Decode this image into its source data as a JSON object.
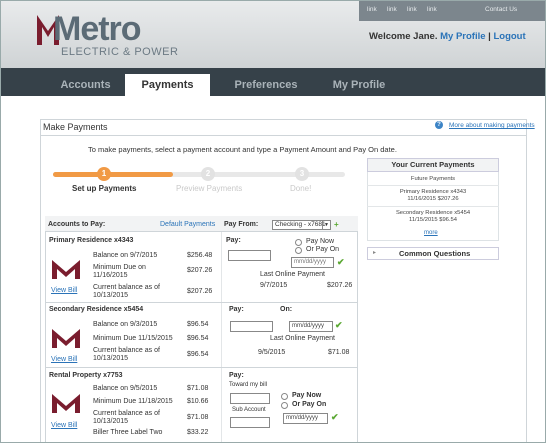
{
  "header": {
    "logo_title": "Metro",
    "logo_subtitle": "ELECTRIC & POWER",
    "top_links": [
      "link",
      "link",
      "link",
      "link",
      "Contact Us"
    ],
    "welcome_prefix": "Welcome Jane.",
    "my_profile": "My Profile",
    "separator": "|",
    "logout": "Logout"
  },
  "nav": {
    "tabs": [
      {
        "label": "Accounts"
      },
      {
        "label": "Payments"
      },
      {
        "label": "Preferences"
      },
      {
        "label": "My Profile"
      }
    ]
  },
  "panel": {
    "title": "Make Payments",
    "more_about": "More about making payments",
    "instruction": "To make payments, select a payment account and type a Payment Amount and Pay On date."
  },
  "steps": [
    {
      "number": "1",
      "label": "Set up Payments"
    },
    {
      "number": "2",
      "label": "Preview Payments"
    },
    {
      "number": "3",
      "label": "Done!"
    }
  ],
  "current_payments": {
    "title": "Your Current Payments",
    "subtitle": "Future Payments",
    "items": [
      {
        "line1": "Primary Residence x4343",
        "line2": "11/16/2015  $207.26"
      },
      {
        "line1": "Secondary Residence x5454",
        "line2": "11/15/2015  $96.54"
      }
    ],
    "more": "more"
  },
  "common_questions": {
    "caret": "▸",
    "label": "Common Questions"
  },
  "accounts": {
    "header_label": "Accounts to Pay:",
    "default_payments": "Default Payments",
    "pay_from_label": "Pay From:",
    "pay_from_value": "Checking - x7681",
    "rows": [
      {
        "name": "Primary Residence x4343",
        "lines": [
          {
            "label": "Balance on 9/7/2015",
            "amount": "$256.48"
          },
          {
            "label": "Minimum Due on 11/16/2015",
            "amount": "$207.26"
          },
          {
            "label": "Current balance as of 10/13/2015",
            "amount": "$207.26"
          }
        ],
        "view_bill": "View Bill",
        "pay_label": "Pay:",
        "pay_now": "Pay Now",
        "pay_on": "Or Pay On",
        "date_placeholder": "mm/dd/yyyy",
        "last_online": "Last Online Payment",
        "last_date": "9/7/2015",
        "last_amount": "$207.26"
      },
      {
        "name": "Secondary Residence x5454",
        "lines": [
          {
            "label": "Balance on 9/3/2015",
            "amount": "$96.54"
          },
          {
            "label": "Minimum Due 11/15/2015",
            "amount": "$96.54"
          },
          {
            "label": "Current balance as of 10/13/2015",
            "amount": "$96.54"
          }
        ],
        "view_bill": "View Bill",
        "pay_label": "Pay:",
        "on_label": "On:",
        "date_placeholder": "mm/dd/yyyy",
        "last_online": "Last Online Payment",
        "last_date": "9/5/2015",
        "last_amount": "$71.08"
      },
      {
        "name": "Rental Property x7753",
        "lines": [
          {
            "label": "Balance on 9/5/2015",
            "amount": "$71.08"
          },
          {
            "label": "Minimum Due 11/18/2015",
            "amount": "$10.66"
          },
          {
            "label": "Current balance as of 10/13/2015",
            "amount": "$71.08"
          },
          {
            "label": "Biller Three Label Two",
            "amount": "$33.22"
          }
        ],
        "view_bill": "View Bill",
        "pay_label": "Pay:",
        "toward_bill": "Toward my bill",
        "sub_account": "Sub Account",
        "pay_now": "Pay Now",
        "pay_on": "Or Pay On",
        "date_placeholder": "mm/dd/yyyy"
      }
    ]
  },
  "colors": {
    "accent": "#f19a45",
    "link": "#2a73b8",
    "nav": "#364149",
    "logo_m": "#7a1d2e"
  }
}
